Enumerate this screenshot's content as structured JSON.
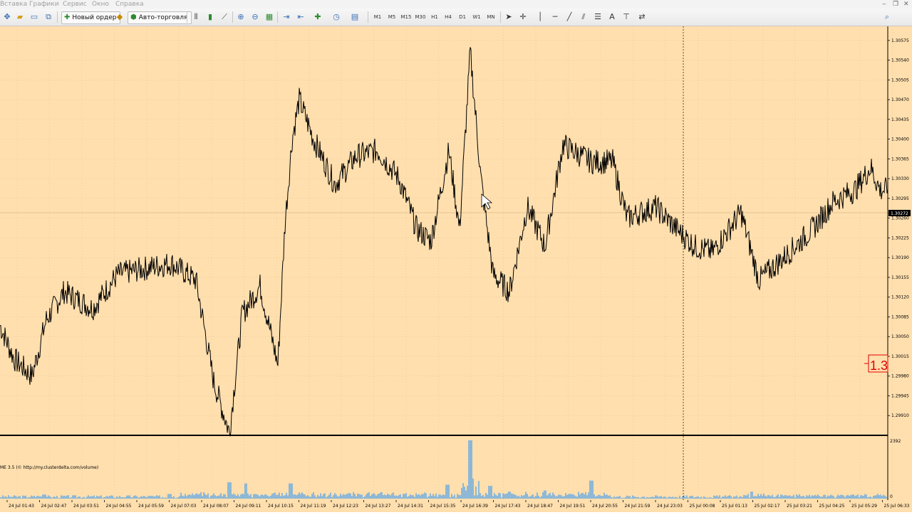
{
  "menu": {
    "items": [
      "Вставка",
      "Графики",
      "Сервис",
      "Окно",
      "Справка"
    ],
    "window_controls": [
      "‒",
      "❐",
      "✕"
    ]
  },
  "toolbar": {
    "new_order_label": "Новый ордер",
    "autotrading_label": "Авто-торговля",
    "timeframes": [
      "M1",
      "M5",
      "M15",
      "M30",
      "H1",
      "H4",
      "D1",
      "W1",
      "MN"
    ],
    "drawing_tools": {
      "text_tool": "A"
    }
  },
  "colors": {
    "chart_background": "#ffdfae",
    "price_line": "#000000",
    "volume_bars": "#1e90ff",
    "alert_box": "#e00000",
    "grid": "#d9b98a",
    "current_price_badge": "#000000"
  },
  "price_axis": {
    "labels": [
      "1.30575",
      "1.30540",
      "1.30505",
      "1.30470",
      "1.30435",
      "1.30400",
      "1.30365",
      "1.30330",
      "1.30295",
      "1.30260",
      "1.30225",
      "1.30190",
      "1.30155",
      "1.30120",
      "1.30085",
      "1.30050",
      "1.30015",
      "1.29980",
      "1.29945",
      "1.29910"
    ],
    "current_price": "1.30272"
  },
  "alert_box": {
    "text": "1.3"
  },
  "indicator": {
    "label": "ME 3.5 (© http://my.clusterdelta.com/volume)",
    "max_value": "2392",
    "min_value": "0"
  },
  "time_axis": {
    "labels": [
      "24 Jul 01:43",
      "24 Jul 02:47",
      "24 Jul 03:51",
      "24 Jul 04:55",
      "24 Jul 05:59",
      "24 Jul 07:03",
      "24 Jul 08:07",
      "24 Jul 09:11",
      "24 Jul 10:15",
      "24 Jul 11:19",
      "24 Jul 12:23",
      "24 Jul 13:27",
      "24 Jul 14:31",
      "24 Jul 15:35",
      "24 Jul 16:39",
      "24 Jul 17:43",
      "24 Jul 18:47",
      "24 Jul 19:51",
      "24 Jul 20:55",
      "24 Jul 21:59",
      "24 Jul 23:03",
      "25 Jul 00:08",
      "25 Jul 01:13",
      "25 Jul 02:17",
      "25 Jul 03:21",
      "25 Jul 04:25",
      "25 Jul 05:29",
      "25 Jul 06:33"
    ]
  },
  "chart_data": {
    "type": "line",
    "symbol_pair_scale": "price",
    "ylim": [
      1.29875,
      1.306
    ],
    "price_keypoints": [
      [
        0,
        1.3007
      ],
      [
        20,
        1.3001
      ],
      [
        45,
        1.2998
      ],
      [
        65,
        1.3008
      ],
      [
        90,
        1.3013
      ],
      [
        130,
        1.301
      ],
      [
        165,
        1.3016
      ],
      [
        200,
        1.3017
      ],
      [
        240,
        1.3018
      ],
      [
        275,
        1.3015
      ],
      [
        300,
        1.2997
      ],
      [
        322,
        1.2988
      ],
      [
        340,
        1.3009
      ],
      [
        365,
        1.3014
      ],
      [
        390,
        1.3
      ],
      [
        400,
        1.3025
      ],
      [
        410,
        1.304
      ],
      [
        420,
        1.3047
      ],
      [
        440,
        1.304
      ],
      [
        470,
        1.3032
      ],
      [
        500,
        1.3037
      ],
      [
        530,
        1.3038
      ],
      [
        560,
        1.3033
      ],
      [
        585,
        1.3024
      ],
      [
        605,
        1.3022
      ],
      [
        630,
        1.3038
      ],
      [
        645,
        1.3024
      ],
      [
        660,
        1.30555
      ],
      [
        675,
        1.3033
      ],
      [
        692,
        1.3016
      ],
      [
        715,
        1.3013
      ],
      [
        740,
        1.3028
      ],
      [
        765,
        1.3021
      ],
      [
        790,
        1.3039
      ],
      [
        830,
        1.3036
      ],
      [
        860,
        1.3036
      ],
      [
        880,
        1.3026
      ],
      [
        920,
        1.3028
      ],
      [
        950,
        1.3024
      ],
      [
        975,
        1.3021
      ],
      [
        1000,
        1.302
      ],
      [
        1040,
        1.3027
      ],
      [
        1065,
        1.3015
      ],
      [
        1100,
        1.3019
      ],
      [
        1140,
        1.3024
      ],
      [
        1170,
        1.3029
      ],
      [
        1200,
        1.3031
      ],
      [
        1222,
        1.3035
      ],
      [
        1235,
        1.3031
      ],
      [
        1246,
        1.3031
      ]
    ],
    "volume_spikes": [
      [
        62,
        0.07
      ],
      [
        238,
        0.08
      ],
      [
        322,
        0.28
      ],
      [
        345,
        0.26
      ],
      [
        408,
        0.26
      ],
      [
        628,
        0.24
      ],
      [
        660,
        1.0
      ],
      [
        688,
        0.22
      ],
      [
        715,
        0.12
      ],
      [
        765,
        0.14
      ],
      [
        830,
        0.31
      ],
      [
        1055,
        0.12
      ]
    ],
    "vertical_marker_label": ""
  }
}
